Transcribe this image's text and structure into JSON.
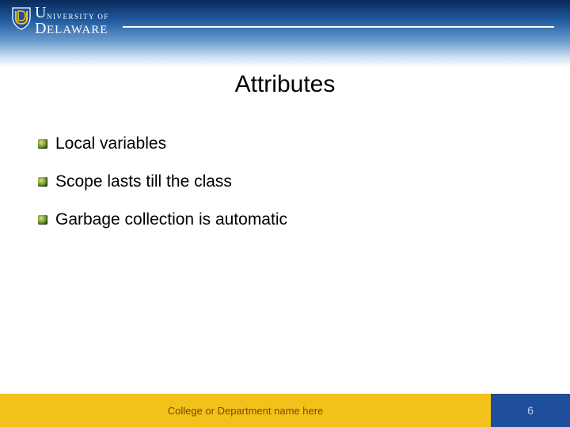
{
  "logo": {
    "line1": "NIVERSITY OF",
    "big1": "U",
    "line2": "ELAWARE",
    "big2": "D"
  },
  "title": "Attributes",
  "bullets": [
    "Local variables",
    "Scope lasts till the class",
    "Garbage collection is automatic"
  ],
  "footer": {
    "dept": "College or Department name here",
    "page": "6"
  }
}
